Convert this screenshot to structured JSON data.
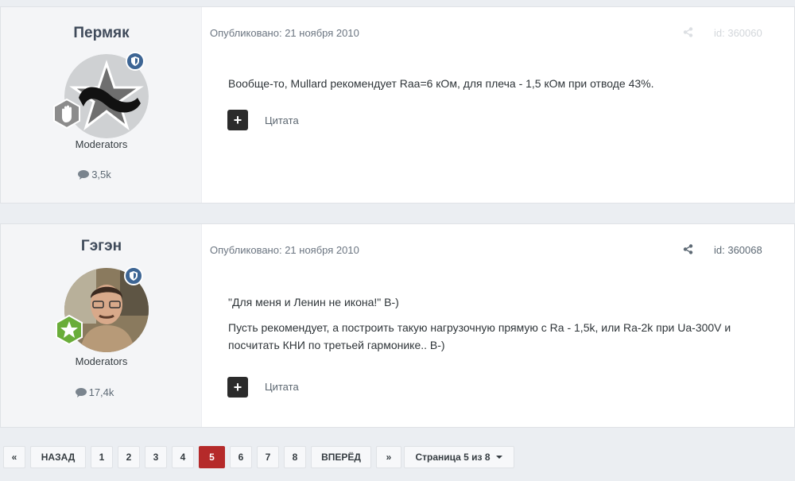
{
  "posts": [
    {
      "author": "Пермяк",
      "group": "Moderators",
      "post_count": "3,5k",
      "date_label": "Опубликовано: 21 ноября 2010",
      "post_id": "id: 360060",
      "body": [
        "Вообще-то, Mullard рекомендует Raa=6 кОм, для плеча - 1,5 кОм при отводе 43%."
      ],
      "quote_label": "Цитата",
      "quote_icon": "+"
    },
    {
      "author": "Гэгэн",
      "group": "Moderators",
      "post_count": "17,4k",
      "date_label": "Опубликовано: 21 ноября 2010",
      "post_id": "id: 360068",
      "body": [
        "\"Для меня и Ленин не икона!\" B-)",
        "Пусть рекомендует, а построить такую нагрузочную прямую с Ra - 1,5k, или Ra-2k при Ua-300V и посчитать КНИ по третьей гармонике.. B-)"
      ],
      "quote_label": "Цитата",
      "quote_icon": "+"
    }
  ],
  "pagination": {
    "first": "«",
    "prev": "НАЗАД",
    "pages": [
      "1",
      "2",
      "3",
      "4",
      "5",
      "6",
      "7",
      "8"
    ],
    "current": "5",
    "next": "ВПЕРЁД",
    "last": "»",
    "page_select": "Страница 5 из 8"
  },
  "colors": {
    "accent": "#b52a2a",
    "badge": "#3d6594"
  }
}
